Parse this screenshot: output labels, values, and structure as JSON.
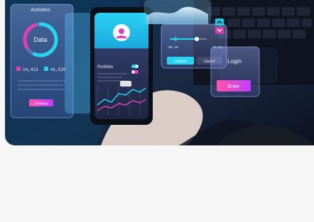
{
  "hero": {
    "activities_panel": {
      "title": "Activities",
      "ring_label": "Data",
      "stat_a": "14,413",
      "stat_b": "41,520",
      "button_label": "Continue"
    },
    "phone": {
      "portfolio_label": "Portfolio"
    },
    "controls_panel": {
      "value_left": "08:48",
      "value_right": "41.32",
      "button_primary": "Confirm",
      "button_secondary": "Cancel"
    },
    "login_panel": {
      "title": "Login",
      "enter_button": "Enter"
    }
  },
  "colors": {
    "accent_cyan": "#28d3f2",
    "accent_magenta": "#e23fb1",
    "accent_pink": "#ff4fa5",
    "dark_navy": "#1b2239"
  },
  "icons": {
    "avatar": "user-avatar-icon",
    "toggle_a": "toggle-icon",
    "toggle_b": "toggle-icon",
    "arrow_up": "chevron-up-icon",
    "arrow_down": "chevron-down-icon"
  }
}
